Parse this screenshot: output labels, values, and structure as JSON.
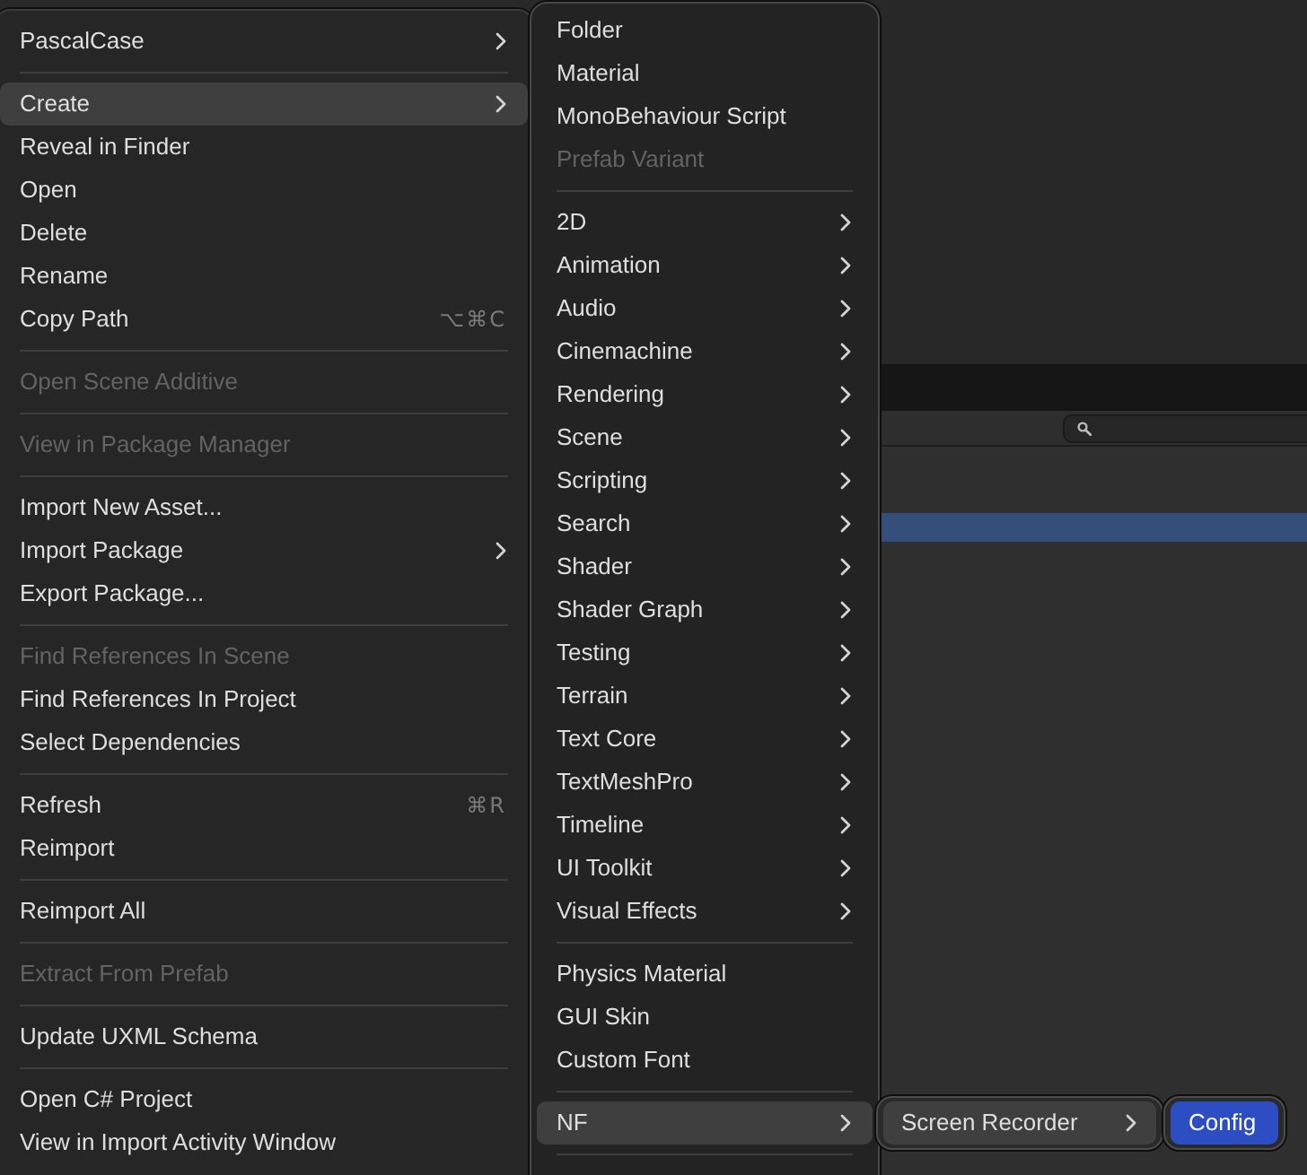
{
  "editor": {
    "rows": [
      {
        "selected": true
      }
    ]
  },
  "context_menu": {
    "items": [
      {
        "kind": "item",
        "label": "PascalCase",
        "has_submenu": true,
        "selected": false,
        "disabled": false
      },
      {
        "kind": "separator"
      },
      {
        "kind": "item",
        "label": "Create",
        "has_submenu": true,
        "selected": true,
        "disabled": false
      },
      {
        "kind": "item",
        "label": "Reveal in Finder",
        "has_submenu": false,
        "selected": false,
        "disabled": false
      },
      {
        "kind": "item",
        "label": "Open",
        "has_submenu": false,
        "selected": false,
        "disabled": false
      },
      {
        "kind": "item",
        "label": "Delete",
        "has_submenu": false,
        "selected": false,
        "disabled": false
      },
      {
        "kind": "item",
        "label": "Rename",
        "has_submenu": false,
        "selected": false,
        "disabled": false
      },
      {
        "kind": "item",
        "label": "Copy Path",
        "has_submenu": false,
        "selected": false,
        "disabled": false,
        "shortcut": "⌥⌘C"
      },
      {
        "kind": "separator"
      },
      {
        "kind": "item",
        "label": "Open Scene Additive",
        "has_submenu": false,
        "selected": false,
        "disabled": true
      },
      {
        "kind": "separator"
      },
      {
        "kind": "item",
        "label": "View in Package Manager",
        "has_submenu": false,
        "selected": false,
        "disabled": true
      },
      {
        "kind": "separator"
      },
      {
        "kind": "item",
        "label": "Import New Asset...",
        "has_submenu": false,
        "selected": false,
        "disabled": false
      },
      {
        "kind": "item",
        "label": "Import Package",
        "has_submenu": true,
        "selected": false,
        "disabled": false
      },
      {
        "kind": "item",
        "label": "Export Package...",
        "has_submenu": false,
        "selected": false,
        "disabled": false
      },
      {
        "kind": "separator"
      },
      {
        "kind": "item",
        "label": "Find References In Scene",
        "has_submenu": false,
        "selected": false,
        "disabled": true
      },
      {
        "kind": "item",
        "label": "Find References In Project",
        "has_submenu": false,
        "selected": false,
        "disabled": false
      },
      {
        "kind": "item",
        "label": "Select Dependencies",
        "has_submenu": false,
        "selected": false,
        "disabled": false
      },
      {
        "kind": "separator"
      },
      {
        "kind": "item",
        "label": "Refresh",
        "has_submenu": false,
        "selected": false,
        "disabled": false,
        "shortcut": "⌘R"
      },
      {
        "kind": "item",
        "label": "Reimport",
        "has_submenu": false,
        "selected": false,
        "disabled": false
      },
      {
        "kind": "separator"
      },
      {
        "kind": "item",
        "label": "Reimport All",
        "has_submenu": false,
        "selected": false,
        "disabled": false
      },
      {
        "kind": "separator"
      },
      {
        "kind": "item",
        "label": "Extract From Prefab",
        "has_submenu": false,
        "selected": false,
        "disabled": true
      },
      {
        "kind": "separator"
      },
      {
        "kind": "item",
        "label": "Update UXML Schema",
        "has_submenu": false,
        "selected": false,
        "disabled": false
      },
      {
        "kind": "separator"
      },
      {
        "kind": "item",
        "label": "Open C# Project",
        "has_submenu": false,
        "selected": false,
        "disabled": false
      },
      {
        "kind": "item",
        "label": "View in Import Activity Window",
        "has_submenu": false,
        "selected": false,
        "disabled": false
      }
    ]
  },
  "create_submenu": {
    "items": [
      {
        "kind": "item",
        "label": "Folder",
        "has_submenu": false,
        "selected": false,
        "disabled": false
      },
      {
        "kind": "item",
        "label": "Material",
        "has_submenu": false,
        "selected": false,
        "disabled": false
      },
      {
        "kind": "item",
        "label": "MonoBehaviour Script",
        "has_submenu": false,
        "selected": false,
        "disabled": false
      },
      {
        "kind": "item",
        "label": "Prefab Variant",
        "has_submenu": false,
        "selected": false,
        "disabled": true
      },
      {
        "kind": "separator"
      },
      {
        "kind": "item",
        "label": "2D",
        "has_submenu": true,
        "selected": false,
        "disabled": false
      },
      {
        "kind": "item",
        "label": "Animation",
        "has_submenu": true,
        "selected": false,
        "disabled": false
      },
      {
        "kind": "item",
        "label": "Audio",
        "has_submenu": true,
        "selected": false,
        "disabled": false
      },
      {
        "kind": "item",
        "label": "Cinemachine",
        "has_submenu": true,
        "selected": false,
        "disabled": false
      },
      {
        "kind": "item",
        "label": "Rendering",
        "has_submenu": true,
        "selected": false,
        "disabled": false
      },
      {
        "kind": "item",
        "label": "Scene",
        "has_submenu": true,
        "selected": false,
        "disabled": false
      },
      {
        "kind": "item",
        "label": "Scripting",
        "has_submenu": true,
        "selected": false,
        "disabled": false
      },
      {
        "kind": "item",
        "label": "Search",
        "has_submenu": true,
        "selected": false,
        "disabled": false
      },
      {
        "kind": "item",
        "label": "Shader",
        "has_submenu": true,
        "selected": false,
        "disabled": false
      },
      {
        "kind": "item",
        "label": "Shader Graph",
        "has_submenu": true,
        "selected": false,
        "disabled": false
      },
      {
        "kind": "item",
        "label": "Testing",
        "has_submenu": true,
        "selected": false,
        "disabled": false
      },
      {
        "kind": "item",
        "label": "Terrain",
        "has_submenu": true,
        "selected": false,
        "disabled": false
      },
      {
        "kind": "item",
        "label": "Text Core",
        "has_submenu": true,
        "selected": false,
        "disabled": false
      },
      {
        "kind": "item",
        "label": "TextMeshPro",
        "has_submenu": true,
        "selected": false,
        "disabled": false
      },
      {
        "kind": "item",
        "label": "Timeline",
        "has_submenu": true,
        "selected": false,
        "disabled": false
      },
      {
        "kind": "item",
        "label": "UI Toolkit",
        "has_submenu": true,
        "selected": false,
        "disabled": false
      },
      {
        "kind": "item",
        "label": "Visual Effects",
        "has_submenu": true,
        "selected": false,
        "disabled": false
      },
      {
        "kind": "separator"
      },
      {
        "kind": "item",
        "label": "Physics Material",
        "has_submenu": false,
        "selected": false,
        "disabled": false
      },
      {
        "kind": "item",
        "label": "GUI Skin",
        "has_submenu": false,
        "selected": false,
        "disabled": false
      },
      {
        "kind": "item",
        "label": "Custom Font",
        "has_submenu": false,
        "selected": false,
        "disabled": false
      },
      {
        "kind": "separator"
      },
      {
        "kind": "item",
        "label": "NF",
        "has_submenu": true,
        "selected": true,
        "disabled": false
      },
      {
        "kind": "separator"
      }
    ]
  },
  "nf_submenu": {
    "items": [
      {
        "kind": "item",
        "label": "Screen Recorder",
        "has_submenu": true,
        "selected": true,
        "disabled": false
      }
    ]
  },
  "screen_recorder_submenu": {
    "items": [
      {
        "kind": "item",
        "label": "Config",
        "has_submenu": false,
        "selected": true,
        "disabled": false
      }
    ]
  }
}
